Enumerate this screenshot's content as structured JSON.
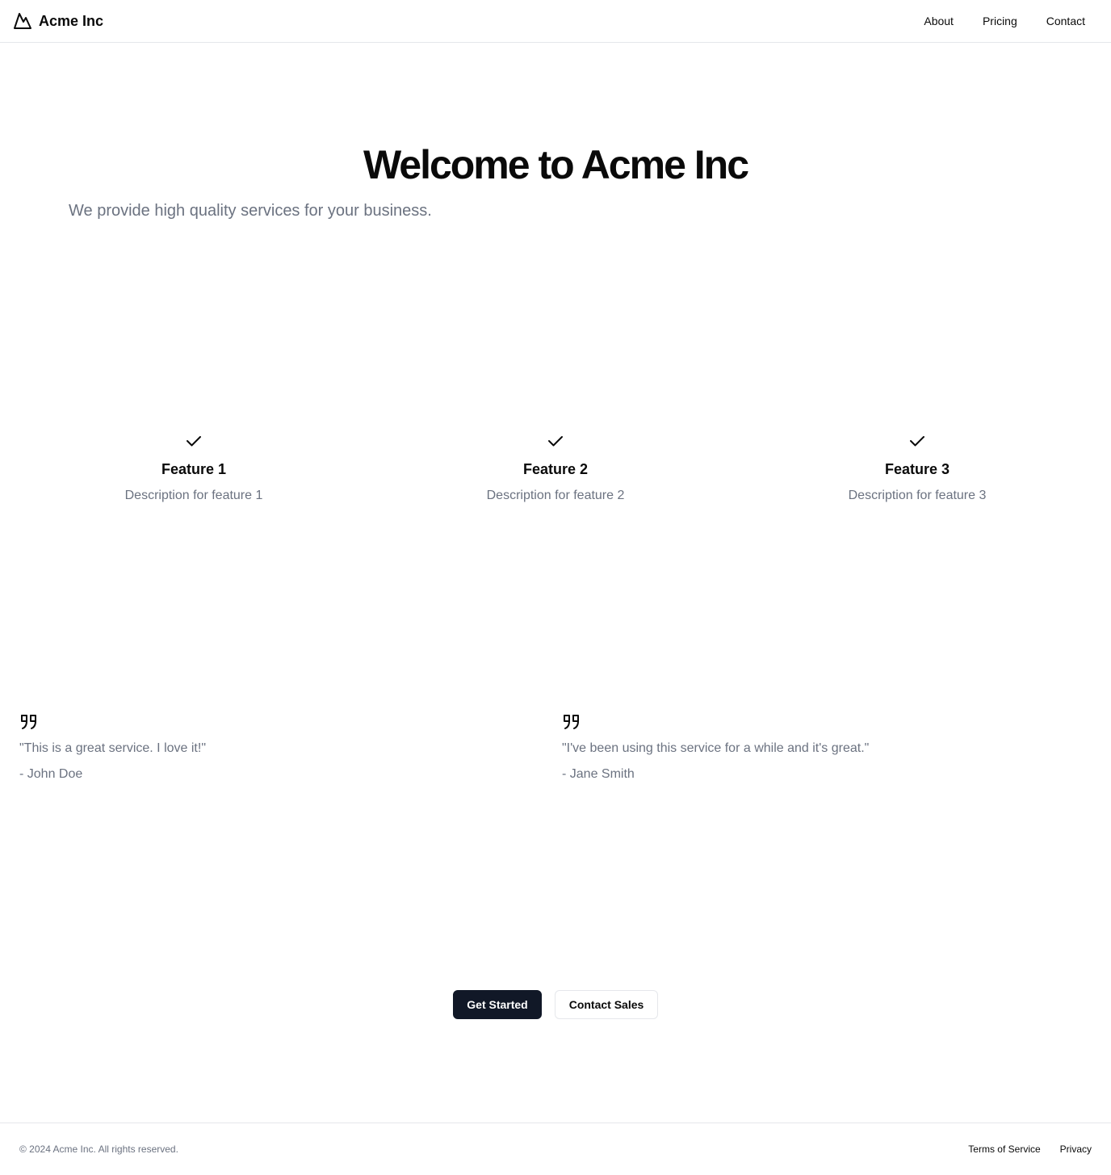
{
  "header": {
    "brand_name": "Acme Inc",
    "brand_icon": "mountain-icon",
    "nav": [
      {
        "label": "About"
      },
      {
        "label": "Pricing"
      },
      {
        "label": "Contact"
      }
    ]
  },
  "hero": {
    "title": "Welcome to Acme Inc",
    "subtitle": "We provide high quality services for your business."
  },
  "features": [
    {
      "icon": "check-icon",
      "title": "Feature 1",
      "description": "Description for feature 1"
    },
    {
      "icon": "check-icon",
      "title": "Feature 2",
      "description": "Description for feature 2"
    },
    {
      "icon": "check-icon",
      "title": "Feature 3",
      "description": "Description for feature 3"
    }
  ],
  "testimonials": [
    {
      "icon": "quote-icon",
      "quote": "\"This is a great service. I love it!\"",
      "author": "- John Doe"
    },
    {
      "icon": "quote-icon",
      "quote": "\"I've been using this service for a while and it's great.\"",
      "author": "- Jane Smith"
    }
  ],
  "cta": {
    "primary_label": "Get Started",
    "secondary_label": "Contact Sales"
  },
  "footer": {
    "copyright": "© 2024 Acme Inc. All rights reserved.",
    "links": [
      {
        "label": "Terms of Service"
      },
      {
        "label": "Privacy"
      }
    ]
  },
  "colors": {
    "text": "#0a0a0a",
    "muted": "#6b7280",
    "primary_button": "#111827",
    "border": "#e5e7eb"
  }
}
